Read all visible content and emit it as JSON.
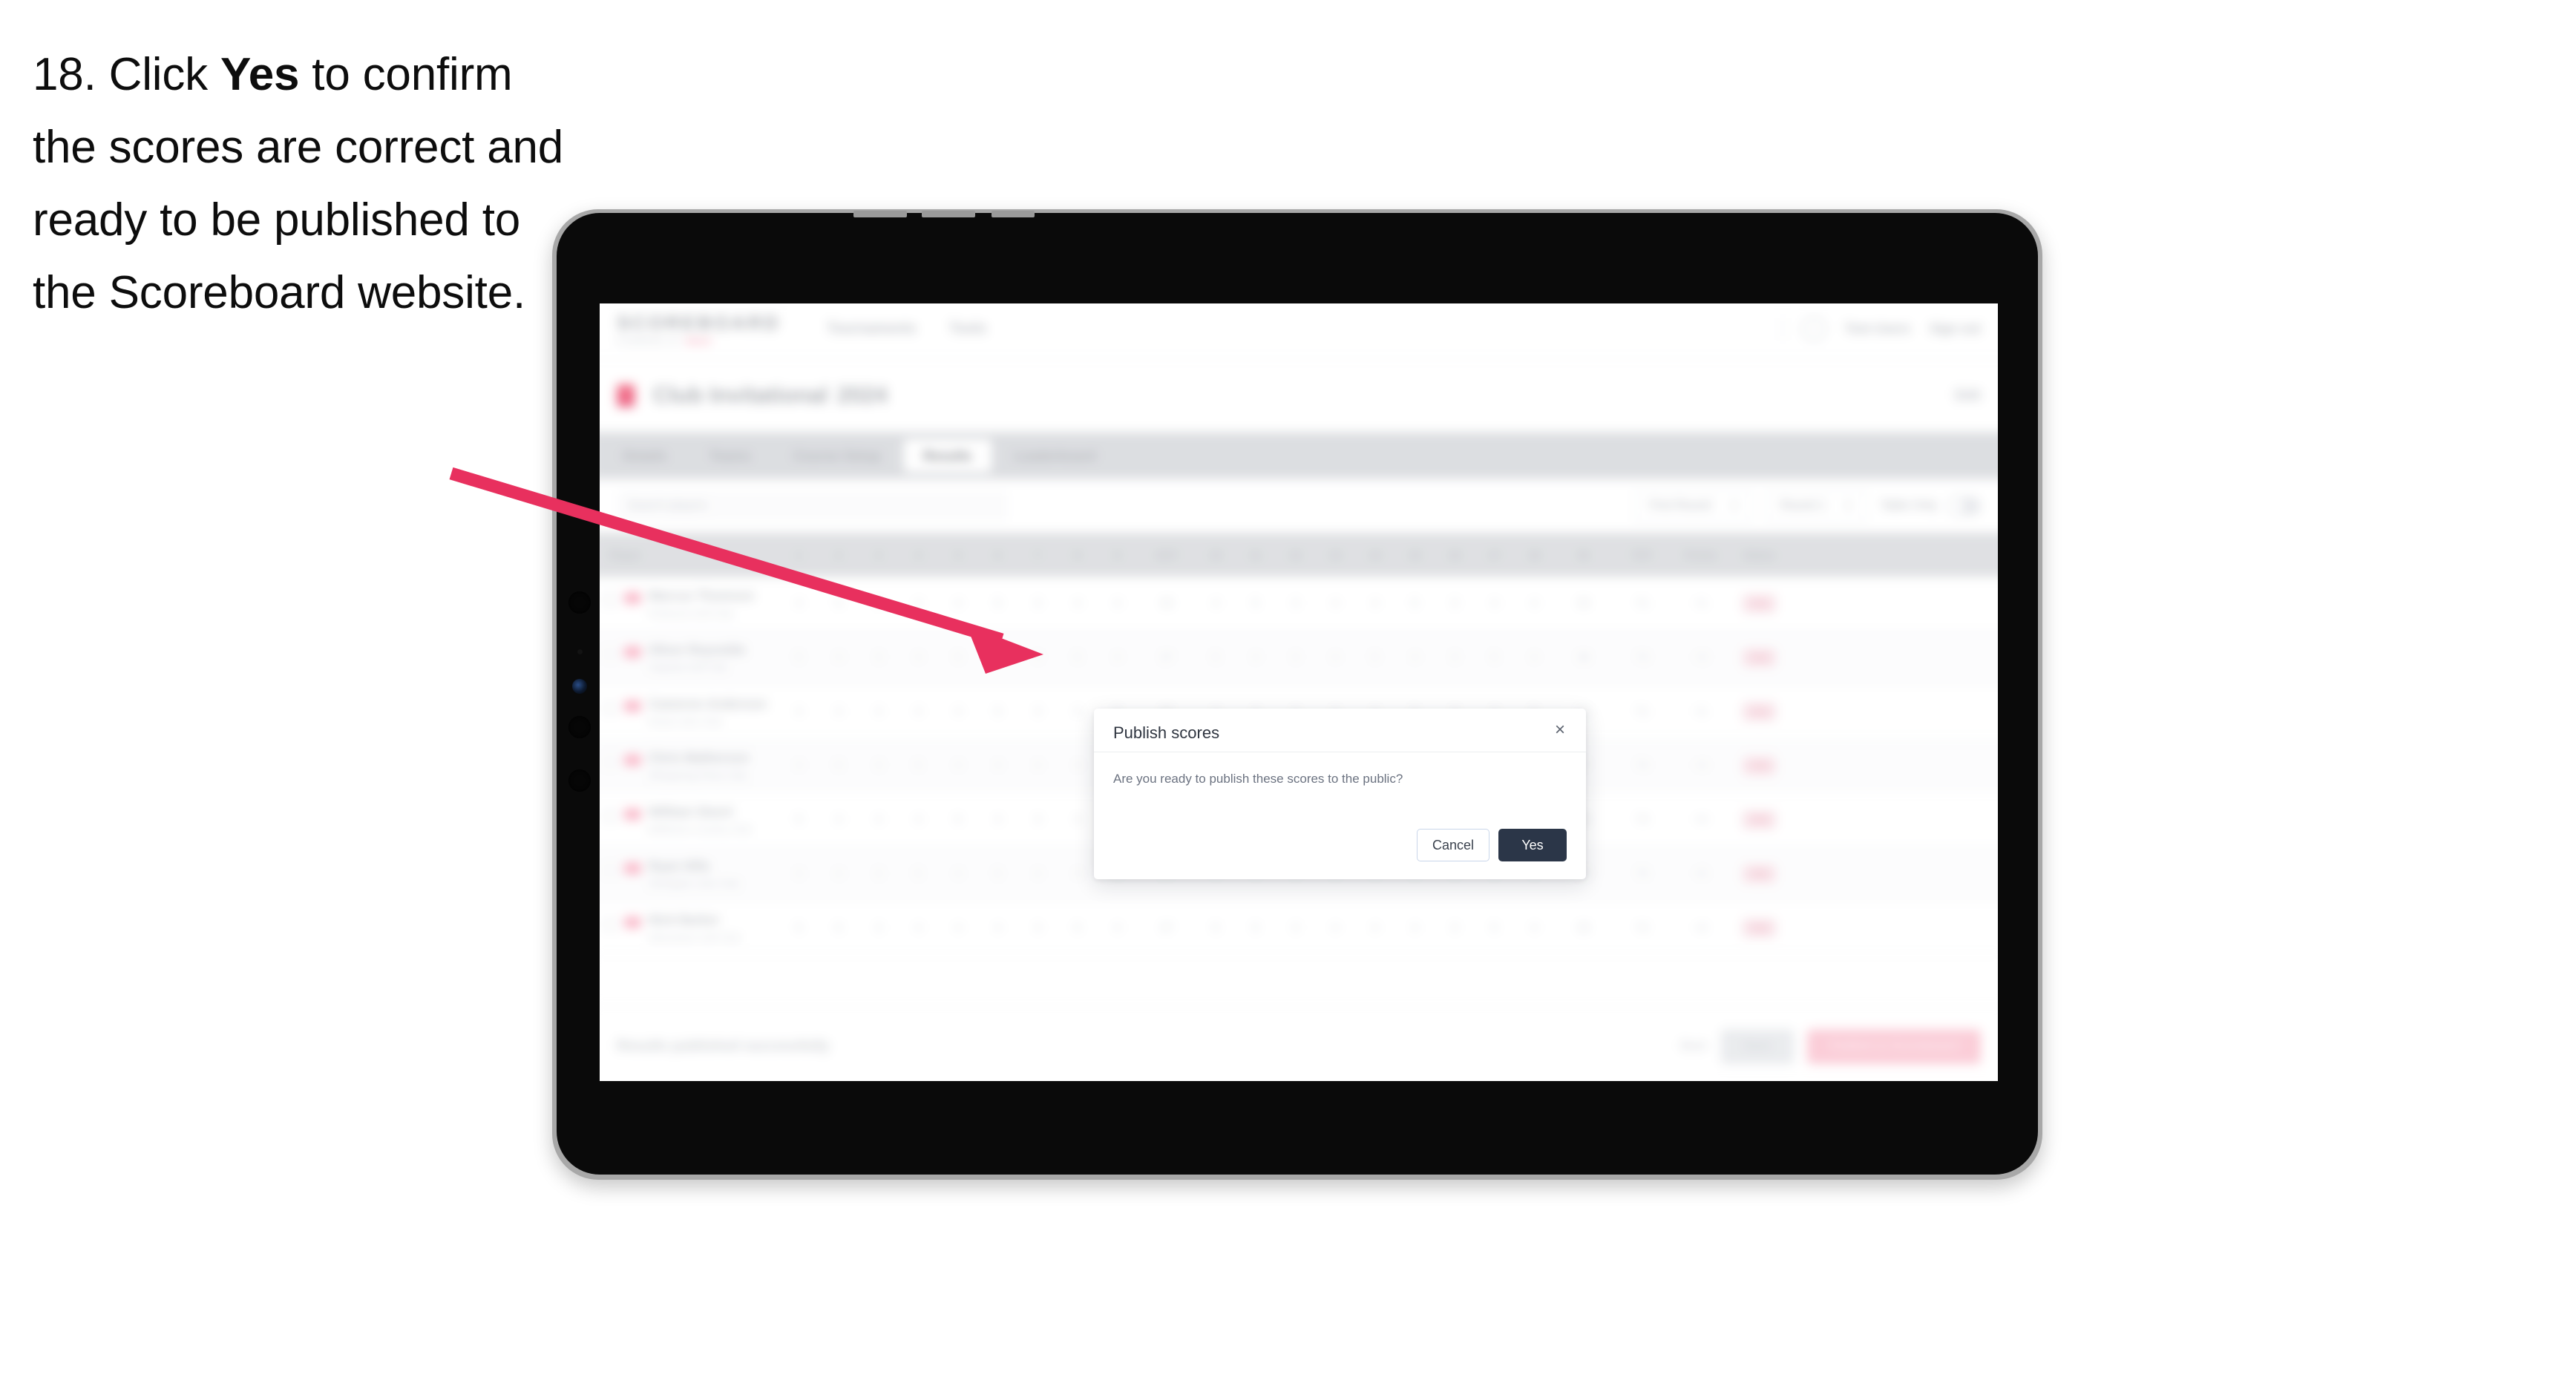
{
  "instruction": {
    "step_number": "18.",
    "before_bold": " Click ",
    "bold": "Yes",
    "after_bold": " to confirm the scores are correct and ready to be published to the Scoreboard website."
  },
  "colors": {
    "arrow": "#e8305e",
    "primary_button": "#2b3648",
    "cancel_border": "#c9d6ea",
    "accent_pink": "#f0718f",
    "tab_bar": "#d5d7db"
  },
  "modal": {
    "title": "Publish scores",
    "close_icon": "×",
    "message": "Are you ready to publish these scores to the public?",
    "cancel_label": "Cancel",
    "confirm_label": "Yes"
  },
  "app": {
    "brand": {
      "word": "SCOREBOARD",
      "sub_prefix": "POWERED BY",
      "sub_accent": "GOLF"
    },
    "header_nav": [
      "Tournaments",
      "Tools"
    ],
    "header_right": {
      "user": "Tom Users",
      "signout": "Sign out"
    },
    "tournament": {
      "name": "Club Invitational",
      "year": "2024",
      "action": "Edit"
    },
    "tabs": [
      {
        "label": "Details",
        "active": false
      },
      {
        "label": "Teams",
        "active": false
      },
      {
        "label": "Course Setup",
        "active": false
      },
      {
        "label": "Results",
        "active": true
      },
      {
        "label": "Leaderboard",
        "active": false
      }
    ],
    "filters": {
      "search_placeholder": "Search players",
      "select_round": "First Round",
      "select_view": "Round 1",
      "toggle_label": "Table Only"
    },
    "table": {
      "columns": {
        "player": "Player",
        "holes": [
          "1",
          "2",
          "3",
          "4",
          "5",
          "6",
          "7",
          "8",
          "9",
          "OUT",
          "10",
          "11",
          "12",
          "13",
          "14",
          "15",
          "16",
          "17",
          "18",
          "IN"
        ],
        "total": "TOT",
        "points": "Points",
        "status": "Status"
      },
      "rows": [
        {
          "name": "Marcus Thomson",
          "club": "Pinehurst Golf Club",
          "holes": [
            "4",
            "5",
            "3",
            "4",
            "4",
            "5",
            "3",
            "4",
            "4"
          ],
          "out": "36",
          "in": "35",
          "tot": "71",
          "pts": "+1"
        },
        {
          "name": "Oliver Reynolds",
          "club": "Augusta Golf Club",
          "holes": [
            "5",
            "4",
            "3",
            "4",
            "5",
            "4",
            "3",
            "5",
            "4"
          ],
          "out": "37",
          "in": "36",
          "tot": "73",
          "pts": "+3"
        },
        {
          "name": "Cameron Anderson",
          "club": "Royal Links Club",
          "holes": [
            "4",
            "4",
            "4",
            "4",
            "4",
            "5",
            "3",
            "4",
            "5"
          ],
          "out": "37",
          "in": "34",
          "tot": "71",
          "pts": "+1"
        },
        {
          "name": "Chris Matherson",
          "club": "Whispering Pines Club",
          "holes": [
            "4",
            "5",
            "3",
            "5",
            "4",
            "4",
            "4",
            "4",
            "4"
          ],
          "out": "37",
          "in": "37",
          "tot": "74",
          "pts": "+4"
        },
        {
          "name": "William Steert",
          "club": "Bellhaven Country Club",
          "holes": [
            "5",
            "4",
            "4",
            "4",
            "5",
            "4",
            "3",
            "4",
            "5"
          ],
          "out": "38",
          "in": "36",
          "tot": "74",
          "pts": "+4"
        },
        {
          "name": "Ryan Hills",
          "club": "Northgate Links Club",
          "holes": [
            "4",
            "4",
            "3",
            "5",
            "4",
            "5",
            "4",
            "4",
            "4"
          ],
          "out": "37",
          "in": "38",
          "tot": "75",
          "pts": "+5"
        },
        {
          "name": "Nick Barker",
          "club": "Silverstone Golf Club",
          "holes": [
            "5",
            "5",
            "3",
            "4",
            "4",
            "4",
            "3",
            "5",
            "4"
          ],
          "out": "37",
          "in": "35",
          "tot": "72",
          "pts": "+2"
        }
      ]
    },
    "footer": {
      "note": "Results published successfully",
      "link": "Back",
      "grey_button": "Save",
      "pink_button": "Publish to Scoreboard"
    }
  }
}
